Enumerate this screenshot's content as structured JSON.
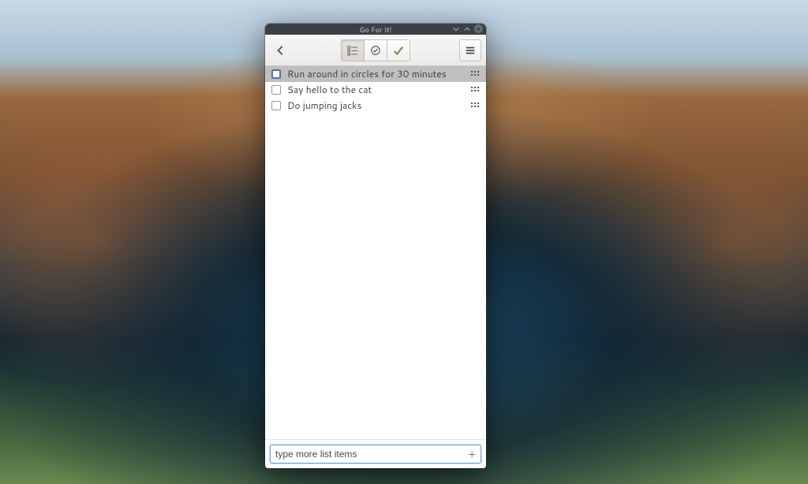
{
  "window": {
    "title": "Go For It!"
  },
  "toolbar": {
    "back_name": "back",
    "view_list_name": "todo list",
    "view_timer_name": "timer",
    "view_done_name": "done",
    "menu_name": "menu",
    "active_view": "list"
  },
  "tasks": [
    {
      "label": "Run around in circles for 30 minutes",
      "checked": false,
      "selected": true
    },
    {
      "label": "Say hello to the cat",
      "checked": false,
      "selected": false
    },
    {
      "label": "Do jumping jacks",
      "checked": false,
      "selected": false
    }
  ],
  "footer": {
    "input_value": "type more list items",
    "add_name": "add task"
  }
}
